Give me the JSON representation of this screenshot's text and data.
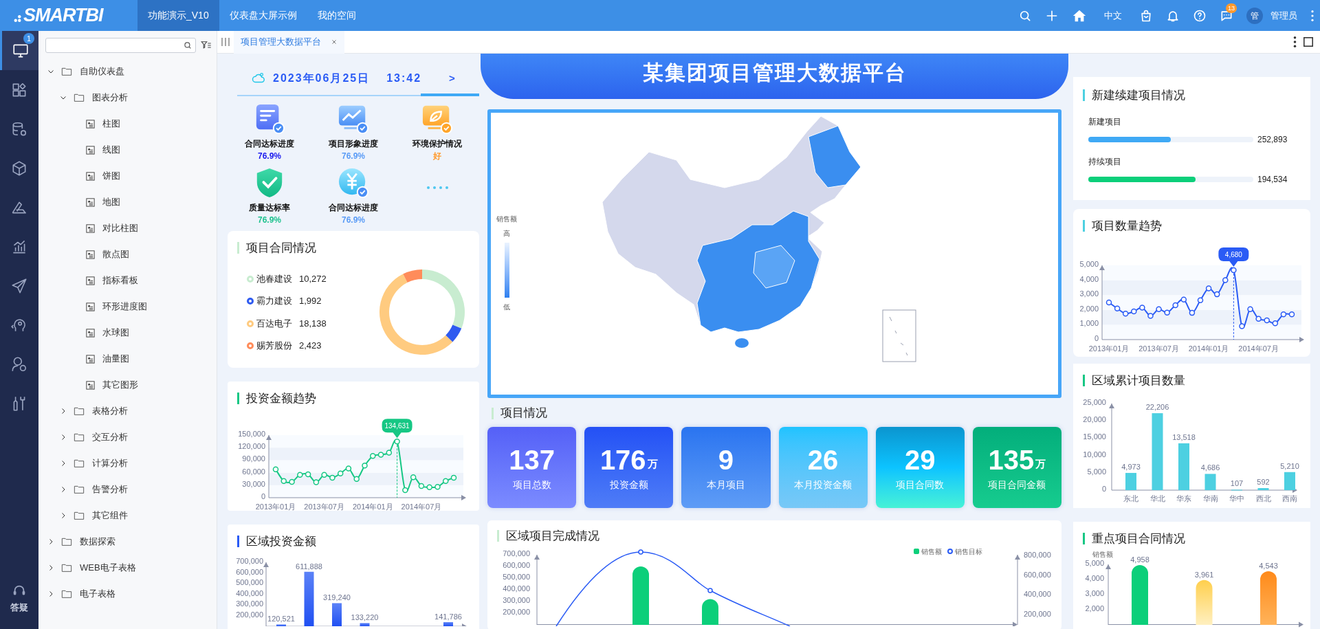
{
  "topbar": {
    "logo": "SMARTBI",
    "nav": [
      {
        "label": "功能演示_V10",
        "selected": true
      },
      {
        "label": "仪表盘大屏示例",
        "selected": false
      },
      {
        "label": "我的空间",
        "selected": false
      }
    ],
    "language": "中文",
    "message_badge": "13",
    "avatar": "管",
    "user": "管理员"
  },
  "rail": {
    "items": [
      {
        "selected": true,
        "badge": "1"
      },
      {
        "selected": false
      },
      {
        "selected": false
      },
      {
        "selected": false
      },
      {
        "selected": false
      },
      {
        "selected": false
      },
      {
        "selected": false
      },
      {
        "selected": false
      },
      {
        "selected": false
      },
      {
        "selected": false
      }
    ],
    "help_label": "答疑"
  },
  "tree": {
    "items": [
      {
        "kind": "folder",
        "label": "自助仪表盘",
        "expanded": true,
        "children": [
          {
            "kind": "folder",
            "label": "图表分析",
            "expanded": true,
            "children": [
              {
                "kind": "report",
                "label": "柱图"
              },
              {
                "kind": "report",
                "label": "线图"
              },
              {
                "kind": "report",
                "label": "饼图"
              },
              {
                "kind": "report",
                "label": "地图"
              },
              {
                "kind": "report",
                "label": "对比柱图"
              },
              {
                "kind": "report",
                "label": "散点图"
              },
              {
                "kind": "report",
                "label": "指标看板"
              },
              {
                "kind": "report",
                "label": "环形进度图"
              },
              {
                "kind": "report",
                "label": "水球图"
              },
              {
                "kind": "report",
                "label": "油量图"
              },
              {
                "kind": "report",
                "label": "其它图形"
              }
            ]
          },
          {
            "kind": "folder",
            "label": "表格分析",
            "expanded": false
          },
          {
            "kind": "folder",
            "label": "交互分析",
            "expanded": false
          },
          {
            "kind": "folder",
            "label": "计算分析",
            "expanded": false
          },
          {
            "kind": "folder",
            "label": "告警分析",
            "expanded": false
          },
          {
            "kind": "folder",
            "label": "其它组件",
            "expanded": false
          }
        ]
      },
      {
        "kind": "folder",
        "label": "数据探索",
        "expanded": false
      },
      {
        "kind": "folder",
        "label": "WEB电子表格",
        "expanded": false
      },
      {
        "kind": "folder",
        "label": "电子表格",
        "expanded": false
      }
    ]
  },
  "tabs": [
    {
      "label": "项目管理大数据平台",
      "selected": true
    }
  ],
  "dashboard": {
    "title": "某集团项目管理大数据平台",
    "date": "2023年06月25日",
    "time": "13:42",
    "next": ">",
    "indicators": [
      {
        "label": "合同达标进度",
        "value": "76.9%",
        "color": "#1a1aee"
      },
      {
        "label": "项目形象进度",
        "value": "76.9%",
        "color": "#5b9cf6"
      },
      {
        "label": "环境保护情况",
        "value": "好",
        "color": "#ff9a2e"
      },
      {
        "label": "质量达标率",
        "value": "76.9%",
        "color": "#1fc28f"
      },
      {
        "label": "合同达标进度",
        "value": "76.9%",
        "color": "#5b9cf6"
      }
    ],
    "contract": {
      "title": "项目合同情况",
      "legend": [
        {
          "label": "池春建设",
          "value": "10,272",
          "color": "#c8ecd0"
        },
        {
          "label": "霸力建设",
          "value": "1,992",
          "color": "#2f5bf0"
        },
        {
          "label": "百达电子",
          "value": "18,138",
          "color": "#ffcb80"
        },
        {
          "label": "赐芳股份",
          "value": "2,423",
          "color": "#ff8c5a"
        }
      ],
      "chart_data": {
        "type": "donut",
        "values": [
          31.29,
          6.07,
          55.26,
          7.38
        ]
      }
    },
    "invest_trend": {
      "title": "投资金额趋势",
      "chart_data": {
        "type": "line",
        "categories": [
          "2013年01月",
          null,
          null,
          null,
          null,
          null,
          "2013年07月",
          null,
          null,
          null,
          null,
          null,
          "2014年01月",
          null,
          null,
          null,
          null,
          null,
          "2014年07月",
          null,
          null,
          null,
          null
        ],
        "values": [
          68000,
          40000,
          38000,
          55000,
          56000,
          37000,
          55000,
          48000,
          58000,
          70000,
          45000,
          77000,
          100000,
          103000,
          108000,
          134631,
          18000,
          49000,
          28000,
          25000,
          26000,
          40000,
          48000
        ],
        "marker": "circle",
        "ylim": [
          0,
          150000
        ],
        "yticks": [
          {
            "value": 0,
            "label": "0"
          },
          {
            "value": 30000,
            "label": "30,000"
          },
          {
            "value": 60000,
            "label": "60,000"
          },
          {
            "value": 90000,
            "label": "90,000"
          },
          {
            "value": 120000,
            "label": "120,000"
          },
          {
            "value": 150000,
            "label": "150,000"
          }
        ],
        "annotations": [
          {
            "y": 134631,
            "text": "134,631"
          }
        ]
      }
    },
    "region_invest": {
      "title": "区域投资金额",
      "chart_data": {
        "type": "bar",
        "categories": [
          null,
          null,
          null,
          null,
          null,
          null,
          null
        ],
        "values": [
          120521,
          611888,
          319240,
          133220,
          null,
          null,
          141786
        ],
        "ylim": [
          100000,
          700000
        ],
        "yticks": [
          {
            "value": 200000,
            "label": "200,000"
          },
          {
            "value": 300000,
            "label": "300,000"
          },
          {
            "value": 400000,
            "label": "400,000"
          },
          {
            "value": 500000,
            "label": "500,000"
          },
          {
            "value": 600000,
            "label": "600,000"
          },
          {
            "value": 700000,
            "label": "700,000"
          }
        ],
        "value_labels": [
          "120,521",
          "611,888",
          "319,240",
          "133,220",
          null,
          null,
          "141,786"
        ]
      }
    },
    "map": {
      "legend_title": "销售额",
      "legend_high": "高",
      "legend_low": "低"
    },
    "kpi_title": "项目情况",
    "kpis": [
      {
        "value": "137",
        "label": "项目总数"
      },
      {
        "value": "176",
        "unit": "万",
        "label": "投资金额"
      },
      {
        "value": "9",
        "label": "本月项目"
      },
      {
        "value": "26",
        "label": "本月投资金额"
      },
      {
        "value": "29",
        "label": "项目合同数"
      },
      {
        "value": "135",
        "unit": "万",
        "label": "项目合同金额"
      }
    ],
    "completion": {
      "title": "区域项目完成情况",
      "legend": [
        {
          "label": "销售额",
          "color": "#0ccf7a"
        },
        {
          "label": "销售目标",
          "color": "#2a5bf5"
        }
      ],
      "right_axis_ticks": [
        "800,000",
        "600,000",
        "400,000",
        "200,000"
      ],
      "chart_data": {
        "type": "bar",
        "categories": [
          null,
          null,
          null,
          null,
          null,
          null,
          null
        ],
        "values": [
          null,
          600000,
          320000,
          null,
          null,
          null,
          null
        ],
        "ylim": [
          100000,
          700000
        ],
        "yticks": [
          {
            "value": 200000,
            "label": "200,000"
          },
          {
            "value": 300000,
            "label": "300,000"
          },
          {
            "value": 400000,
            "label": "400,000"
          },
          {
            "value": 500000,
            "label": "500,000"
          },
          {
            "value": 600000,
            "label": "600,000"
          },
          {
            "value": 700000,
            "label": "700,000"
          }
        ]
      }
    },
    "new_projects": {
      "title": "新建续建项目情况",
      "items": [
        {
          "label": "新建项目",
          "level": 0.5,
          "value": "252,893",
          "color": "#3fa9f5"
        },
        {
          "label": "持续项目",
          "level": 0.65,
          "value": "194,534",
          "color": "#0ccf7a"
        }
      ]
    },
    "count_trend": {
      "title": "项目数量趋势",
      "chart_data": {
        "type": "line",
        "categories": [
          "2013年01月",
          null,
          null,
          null,
          null,
          null,
          "2013年07月",
          null,
          null,
          null,
          null,
          null,
          "2014年01月",
          null,
          null,
          null,
          null,
          null,
          "2014年07月",
          null,
          null,
          null,
          null
        ],
        "values": [
          2500,
          2100,
          1750,
          1900,
          2150,
          1600,
          2050,
          1820,
          2320,
          2700,
          1800,
          2650,
          3450,
          3050,
          4000,
          4680,
          900,
          2050,
          1400,
          1300,
          1100,
          1700,
          1700
        ],
        "marker": "circle",
        "ylim": [
          0,
          5000
        ],
        "yticks": [
          {
            "value": 0,
            "label": "0"
          },
          {
            "value": 1000,
            "label": "1,000"
          },
          {
            "value": 2000,
            "label": "2,000"
          },
          {
            "value": 3000,
            "label": "3,000"
          },
          {
            "value": 4000,
            "label": "4,000"
          },
          {
            "value": 5000,
            "label": "5,000"
          }
        ],
        "annotations": [
          {
            "y": 4680,
            "text": "4,680"
          }
        ]
      }
    },
    "region_count": {
      "title": "区域累计项目数量",
      "chart_data": {
        "type": "bar",
        "categories": [
          "东北",
          "华北",
          "华东",
          "华南",
          "华中",
          "西北",
          "西南"
        ],
        "values": [
          4973,
          22206,
          13518,
          4686,
          107,
          592,
          5210
        ],
        "ylim": [
          0,
          25000
        ],
        "yticks": [
          {
            "value": 0,
            "label": "0"
          },
          {
            "value": 5000,
            "label": "5,000"
          },
          {
            "value": 10000,
            "label": "10,000"
          },
          {
            "value": 15000,
            "label": "15,000"
          },
          {
            "value": 20000,
            "label": "20,000"
          },
          {
            "value": 25000,
            "label": "25,000"
          }
        ],
        "value_labels": [
          "4,973",
          "22,206",
          "13,518",
          "4,686",
          "107",
          "592",
          "5,210"
        ]
      }
    },
    "key_contract": {
      "title": "重点项目合同情况",
      "chart_data": {
        "type": "bar",
        "ylabel": "销售额",
        "categories": [
          null,
          null,
          null
        ],
        "values": [
          4958,
          3961,
          4543
        ],
        "ylim": [
          1000,
          5000
        ],
        "yticks": [
          {
            "value": 2000,
            "label": "2,000"
          },
          {
            "value": 3000,
            "label": "3,000"
          },
          {
            "value": 4000,
            "label": "4,000"
          },
          {
            "value": 5000,
            "label": "5,000"
          }
        ],
        "value_labels": [
          "4,958",
          "3,961",
          "4,543"
        ]
      }
    }
  }
}
